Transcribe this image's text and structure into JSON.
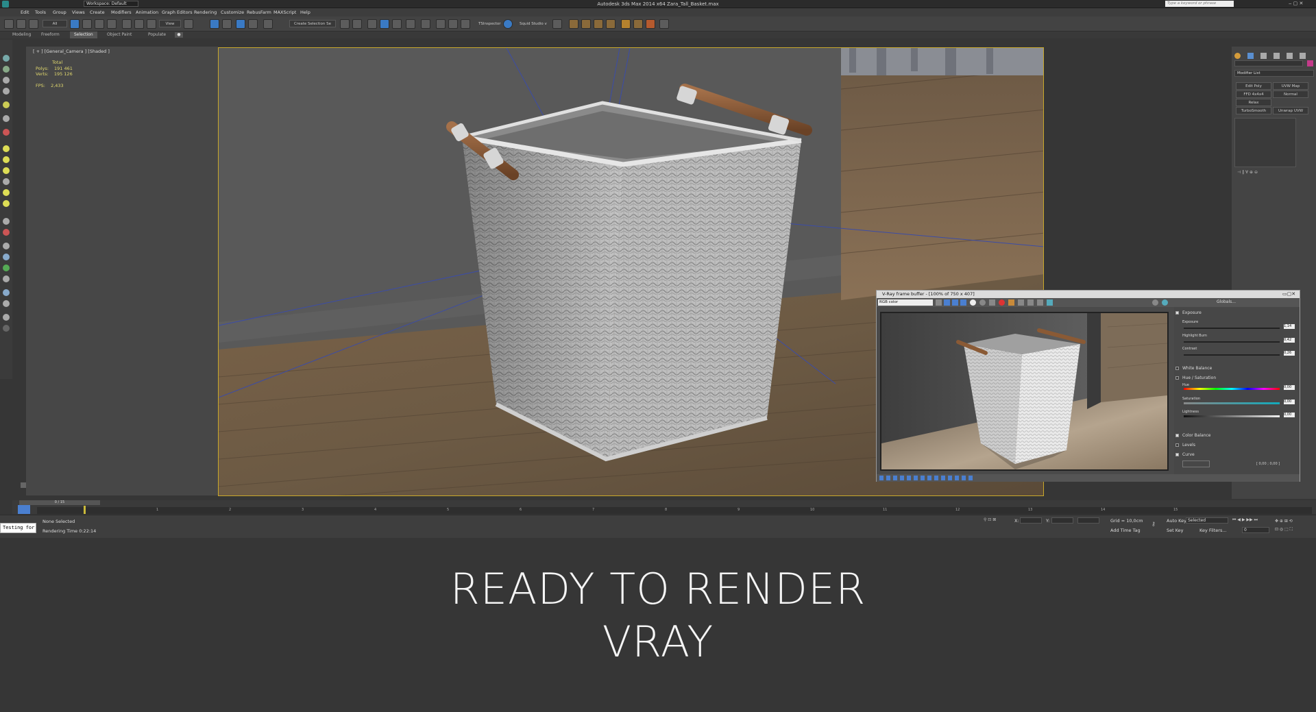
{
  "app": {
    "title": "Autodesk 3ds Max  2014 x64    Zara_Tall_Basket.max",
    "workspace": "Workspace: Default",
    "search_placeholder": "Type a keyword or phrase"
  },
  "menu": [
    "Edit",
    "Tools",
    "Group",
    "Views",
    "Create",
    "Modifiers",
    "Animation",
    "Graph Editors",
    "Rendering",
    "Customize",
    "RebusFarm",
    "MAXScript",
    "Help"
  ],
  "toolbar": {
    "selection_filter": "All",
    "ref_coord": "View",
    "named_selection": "Create Selection Se",
    "plugins": [
      "TSInspector",
      "Squid Studio v"
    ]
  },
  "ribbon_tabs": [
    "Modeling",
    "Freeform",
    "Selection",
    "Object Paint",
    "Populate"
  ],
  "ribbon_active": "Selection",
  "viewport": {
    "label": "[ + ] [General_Camera ] [Shaded ]",
    "stats": {
      "total_label": "Total",
      "polys_label": "Polys:",
      "polys": "191 461",
      "verts_label": "Verts:",
      "verts": "195 126",
      "fps_label": "FPS:",
      "fps": "2,433"
    }
  },
  "command_panel": {
    "modifier_list": "Modifier List",
    "buttons": [
      "Edit Poly",
      "UVW Map",
      "FFD 4x4x4",
      "Normal",
      "Relax",
      "TurboSmooth",
      "Unwrap UVW"
    ]
  },
  "vfb": {
    "title": "V-Ray frame buffer - [100% of 750 x 407]",
    "channel": "RGB color",
    "globals": "Globals...",
    "corrections": [
      {
        "label": "Exposure",
        "checked": true
      },
      {
        "label": "Exposure",
        "value": "1,14"
      },
      {
        "label": "Highlight Burn",
        "value": "0,42"
      },
      {
        "label": "Contrast",
        "value": "0,26"
      },
      {
        "label": "White Balance",
        "checked": false
      },
      {
        "label": "Hue / Saturation",
        "checked": false
      },
      {
        "label": "Hue",
        "value": "0,00"
      },
      {
        "label": "Saturation",
        "value": "0,00"
      },
      {
        "label": "Lightness",
        "value": "0,00"
      },
      {
        "label": "Color Balance",
        "checked": true
      },
      {
        "label": "Levels",
        "checked": false
      },
      {
        "label": "Curve",
        "checked": true
      }
    ],
    "curve_coords": "[ 0,00 ; 0,00 ]"
  },
  "timeline": {
    "frame": "0 / 15",
    "ticks": [
      "1",
      "2",
      "3",
      "4",
      "5",
      "6",
      "7",
      "8",
      "9",
      "10",
      "11",
      "12",
      "13",
      "14",
      "15"
    ]
  },
  "status": {
    "maxscript": "Testing for",
    "selection": "None Selected",
    "render_time": "Rendering Time  0:22:14",
    "x_label": "X:",
    "y_label": "Y:",
    "grid": "Grid = 10,0cm",
    "add_time_tag": "Add Time Tag",
    "auto_key": "Auto Key",
    "set_key": "Set Key",
    "selected": "Selected",
    "key_filters": "Key Filters...",
    "frame_field": "0"
  },
  "caption": {
    "line1": "READY TO RENDER",
    "line2": "VRAY"
  },
  "colors": {
    "viewport_border": "#c9a92b",
    "stats_text": "#e2d96e",
    "active_tool": "#3a7ac4"
  }
}
